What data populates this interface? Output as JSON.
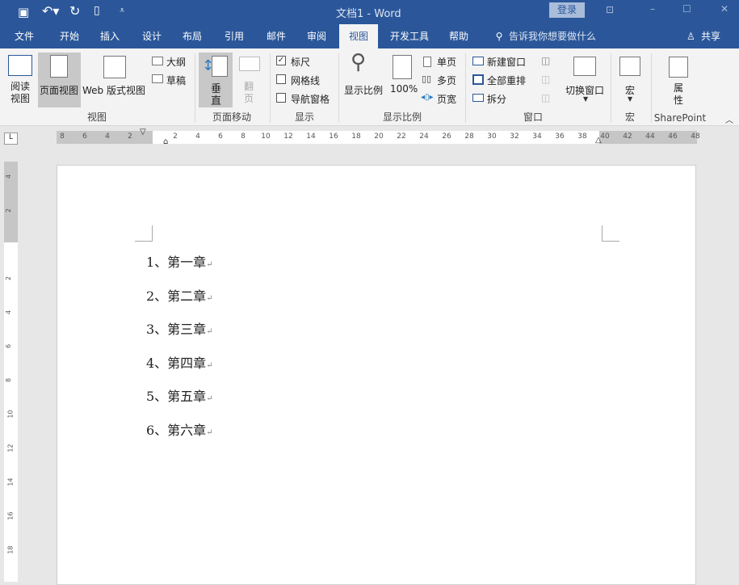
{
  "titlebar": {
    "title": "文档1  -  Word",
    "login": "登录"
  },
  "tabs": [
    "文件",
    "开始",
    "插入",
    "设计",
    "布局",
    "引用",
    "邮件",
    "审阅",
    "视图",
    "开发工具",
    "帮助"
  ],
  "active_tab": "视图",
  "tell_me": "告诉我你想要做什么",
  "share": "共享",
  "ribbon": {
    "views": {
      "read": "阅读\n视图",
      "print": "页面视图",
      "web": "Web 版式视图",
      "outline": "大纲",
      "draft": "草稿",
      "group": "视图"
    },
    "move": {
      "vertical": "垂直",
      "side": "翻页",
      "group": "页面移动"
    },
    "show": {
      "ruler": "标尺",
      "gridlines": "网格线",
      "nav": "导航窗格",
      "group": "显示",
      "ruler_checked": true,
      "gridlines_checked": false,
      "nav_checked": false
    },
    "zoom": {
      "zoom": "显示比例",
      "100": "100%",
      "one": "单页",
      "multi": "多页",
      "width": "页宽",
      "group": "显示比例"
    },
    "window": {
      "new": "新建窗口",
      "arrange": "全部重排",
      "split": "拆分",
      "switch": "切换窗口",
      "group": "窗口"
    },
    "macros": {
      "macro": "宏",
      "group": "宏"
    },
    "sp": {
      "props": "属性",
      "group": "SharePoint"
    }
  },
  "ruler_h": [
    "8",
    "6",
    "4",
    "2",
    "2",
    "4",
    "6",
    "8",
    "10",
    "12",
    "14",
    "16",
    "18",
    "20",
    "22",
    "24",
    "26",
    "28",
    "30",
    "32",
    "34",
    "36",
    "38",
    "40",
    "42",
    "44",
    "46",
    "48"
  ],
  "ruler_v": [
    "4",
    "2",
    "2",
    "4",
    "6",
    "8",
    "10",
    "12",
    "14",
    "16",
    "18"
  ],
  "document": {
    "items": [
      "1、第一章",
      "2、第二章",
      "3、第三章",
      "4、第四章",
      "5、第五章",
      "6、第六章"
    ],
    "mark": "↵"
  }
}
